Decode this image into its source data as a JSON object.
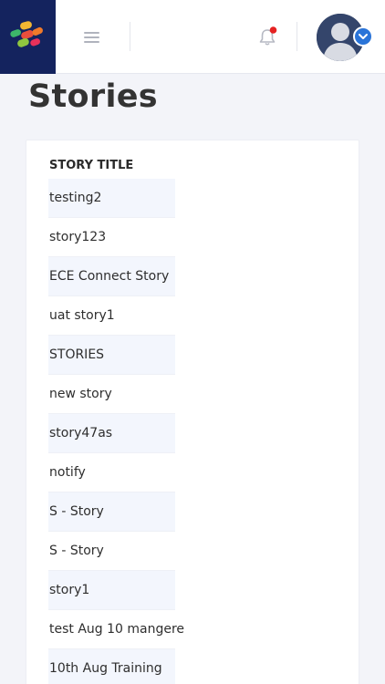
{
  "page": {
    "title": "Stories"
  },
  "header": {
    "notification_dot_color": "#e52222",
    "brand_color": "#14235e",
    "accent_color": "#2a74d8",
    "icons": [
      "logo-icon",
      "hamburger-menu-icon",
      "bell-icon",
      "user-avatar",
      "chevron-down-icon"
    ]
  },
  "table": {
    "column_header": "STORY TITLE",
    "rows": [
      "testing2",
      "story123",
      "ECE Connect Story",
      "uat story1",
      "STORIES",
      "new story",
      "story47as",
      "notify",
      "S - Story",
      "S - Story",
      "story1",
      "test Aug 10 mangere",
      "10th Aug Training"
    ]
  }
}
